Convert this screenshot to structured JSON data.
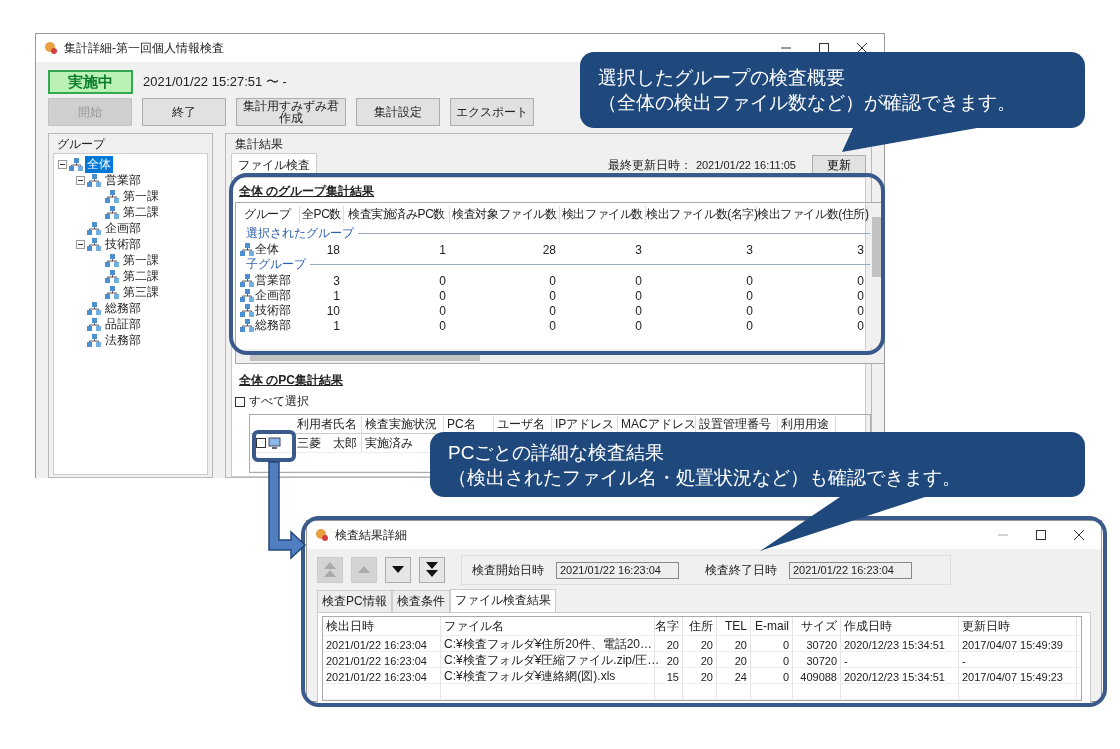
{
  "main_window": {
    "title": "集計詳細-第一回個人情報検査",
    "status_badge": "実施中",
    "period": "2021/01/22 15:27:51 〜 -",
    "toolbar": [
      {
        "label": "開始",
        "disabled": true
      },
      {
        "label": "終了",
        "disabled": false
      },
      {
        "label": "集計用すみずみ君作成",
        "disabled": false
      },
      {
        "label": "集計設定",
        "disabled": false
      },
      {
        "label": "エクスポート",
        "disabled": false
      }
    ],
    "group_panel": {
      "title": "グループ",
      "tree": [
        {
          "label": "全体",
          "selected": true,
          "expanded": true,
          "children": [
            {
              "label": "営業部",
              "selected": false,
              "expanded": true,
              "children": [
                {
                  "label": "第一課",
                  "selected": false
                },
                {
                  "label": "第二課",
                  "selected": false
                }
              ]
            },
            {
              "label": "企画部",
              "selected": false
            },
            {
              "label": "技術部",
              "selected": false,
              "expanded": true,
              "children": [
                {
                  "label": "第一課",
                  "selected": false
                },
                {
                  "label": "第二課",
                  "selected": false
                },
                {
                  "label": "第三課",
                  "selected": false
                }
              ]
            },
            {
              "label": "総務部",
              "selected": false
            },
            {
              "label": "品証部",
              "selected": false
            },
            {
              "label": "法務部",
              "selected": false
            }
          ]
        }
      ]
    },
    "results_panel": {
      "title": "集計結果",
      "tabs": [
        {
          "label": "ファイル検査",
          "selected": true
        }
      ],
      "last_updated_label": "最終更新日時：",
      "last_updated": "2021/01/22 16:11:05",
      "refresh_button": "更新",
      "group_summary": {
        "title": "全体 のグループ集計結果",
        "columns": [
          "グループ",
          "全PC数",
          "検査実施済みPC数",
          "検査対象ファイル数",
          "検出ファイル数",
          "検出ファイル数(名字)",
          "検出ファイル数(住所)"
        ],
        "sections": [
          {
            "label": "選択されたグループ",
            "rows": [
              [
                "全体",
                "18",
                "1",
                "28",
                "3",
                "3",
                "3"
              ]
            ]
          },
          {
            "label": "子グループ",
            "rows": [
              [
                "営業部",
                "3",
                "0",
                "0",
                "0",
                "0",
                "0"
              ],
              [
                "企画部",
                "1",
                "0",
                "0",
                "0",
                "0",
                "0"
              ],
              [
                "技術部",
                "10",
                "0",
                "0",
                "0",
                "0",
                "0"
              ],
              [
                "総務部",
                "1",
                "0",
                "0",
                "0",
                "0",
                "0"
              ]
            ]
          }
        ]
      },
      "pc_summary": {
        "title": "全体 のPC集計結果",
        "select_all": {
          "label": "すべて選択",
          "checked": false
        },
        "columns": [
          "利用者氏名",
          "検査実施状況",
          "PC名",
          "ユーザ名",
          "IPアドレス",
          "MACアドレス",
          "設置管理番号",
          "利用用途"
        ],
        "rows": [
          {
            "checked": false,
            "cells": [
              "三菱　太郎",
              "実施済み"
            ]
          }
        ]
      }
    }
  },
  "callouts": [
    {
      "lines": [
        "選択したグループの検査概要",
        "（全体の検出ファイル数など）が確認できます。"
      ]
    },
    {
      "lines": [
        "PCごとの詳細な検査結果",
        "（検出されたファイル名・処置状況など）も確認できます。"
      ]
    }
  ],
  "detail_window": {
    "title": "検査結果詳細",
    "nav_buttons": [
      {
        "kind": "first",
        "disabled": true
      },
      {
        "kind": "previous",
        "disabled": true
      },
      {
        "kind": "next",
        "disabled": false
      },
      {
        "kind": "last",
        "disabled": false
      }
    ],
    "start_label": "検査開始日時",
    "start_value": "2021/01/22 16:23:04",
    "end_label": "検査終了日時",
    "end_value": "2021/01/22 16:23:04",
    "tabs": [
      {
        "label": "検査PC情報",
        "selected": false
      },
      {
        "label": "検査条件",
        "selected": false
      },
      {
        "label": "ファイル検査結果",
        "selected": true
      }
    ],
    "columns": [
      "検出日時",
      "ファイル名",
      "名字",
      "住所",
      "TEL",
      "E-mail",
      "サイズ",
      "作成日時",
      "更新日時"
    ],
    "rows": [
      [
        "2021/01/22 16:23:04",
        "C:¥検査フォルダ¥住所20件、電話20…",
        "20",
        "20",
        "20",
        "0",
        "30720",
        "2020/12/23 15:34:51",
        "2017/04/07 15:49:39"
      ],
      [
        "2021/01/22 16:23:04",
        "C:¥検査フォルダ¥圧縮ファイル.zip/圧…",
        "20",
        "20",
        "20",
        "0",
        "30720",
        "-",
        "-"
      ],
      [
        "2021/01/22 16:23:04",
        "C:¥検査フォルダ¥連絡網(図).xls",
        "15",
        "20",
        "24",
        "0",
        "409088",
        "2020/12/23 15:34:51",
        "2017/04/07 15:49:23"
      ]
    ]
  }
}
